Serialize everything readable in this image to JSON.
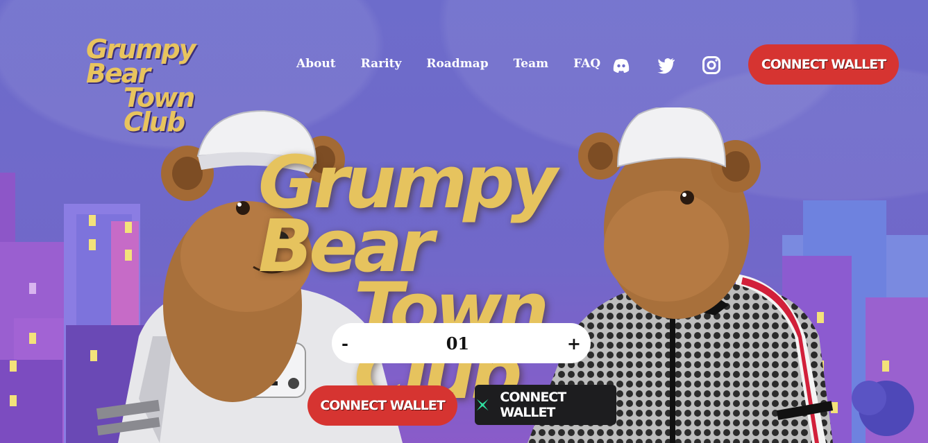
{
  "header": {
    "logo_line1": "Grumpy Bear",
    "logo_line2": "Town Club",
    "nav": [
      "About",
      "Rarity",
      "Roadmap",
      "Team",
      "FAQ"
    ],
    "social": [
      "discord-icon",
      "twitter-icon",
      "instagram-icon"
    ],
    "connect_label": "CONNECT WALLET"
  },
  "hero": {
    "title_line1": "Grumpy Bear",
    "title_line2": "Town Club"
  },
  "mint": {
    "minus": "-",
    "quantity": "01",
    "plus": "+",
    "connect_label": "CONNECT WALLET",
    "alt_connect_label": "CONNECT WALLET"
  },
  "colors": {
    "accent_red": "#d63431",
    "gold": "#e6c35e",
    "bg_purple": "#6c6bc7"
  }
}
